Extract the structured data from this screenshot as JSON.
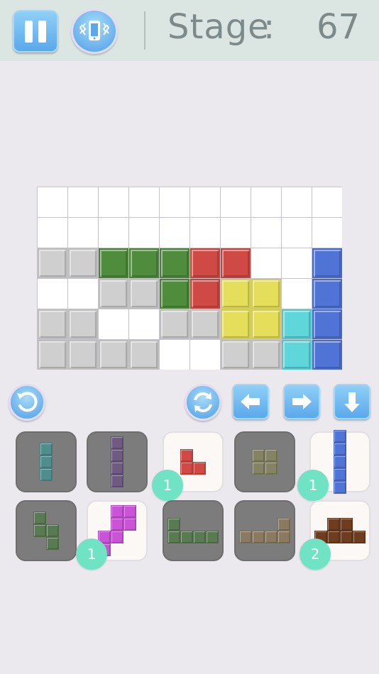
{
  "header": {
    "stage_label": "Stage",
    "stage_colon": ":",
    "stage_number": "67",
    "pause_icon": "pause-icon",
    "vibrate_icon": "phone-vibrate-icon"
  },
  "colors": {
    "gray": "#cfcfcf",
    "green": "#4f8c3c",
    "red": "#d04a45",
    "yellow": "#e5de5a",
    "cyan": "#5fd6d9",
    "blue": "#4f74d6",
    "purple": "#c955d6",
    "brown": "#6e3d1f",
    "teal_dim": "#4f8d8f",
    "purple_dim": "#6f5a82",
    "olive_dim": "#848465",
    "green_dim": "#5a7a54",
    "tan_dim": "#8a7a62"
  },
  "board": {
    "cols": 10,
    "rows": 6,
    "grid": [
      [
        "empty",
        "empty",
        "empty",
        "empty",
        "empty",
        "empty",
        "empty",
        "empty",
        "empty",
        "empty"
      ],
      [
        "empty",
        "empty",
        "empty",
        "empty",
        "empty",
        "empty",
        "empty",
        "empty",
        "empty",
        "empty"
      ],
      [
        "gray",
        "gray",
        "green",
        "green",
        "green",
        "red",
        "red",
        "empty",
        "empty",
        "blue"
      ],
      [
        "empty",
        "empty",
        "gray",
        "gray",
        "green",
        "red",
        "yellow",
        "yellow",
        "empty",
        "blue"
      ],
      [
        "gray",
        "gray",
        "empty",
        "empty",
        "gray",
        "gray",
        "yellow",
        "yellow",
        "cyan",
        "blue"
      ],
      [
        "gray",
        "gray",
        "gray",
        "gray",
        "empty",
        "empty",
        "gray",
        "gray",
        "cyan",
        "blue"
      ]
    ]
  },
  "controls": {
    "undo_icon": "undo-icon",
    "rotate_icon": "rotate-icon",
    "left_icon": "arrow-left-icon",
    "right_icon": "arrow-right-icon",
    "down_icon": "arrow-down-icon"
  },
  "pieces": [
    {
      "state": "used",
      "color": "teal_dim",
      "cells": [
        [
          0,
          0
        ],
        [
          0,
          1
        ],
        [
          0,
          2
        ]
      ],
      "count": ""
    },
    {
      "state": "used",
      "color": "purple_dim",
      "cells": [
        [
          0,
          0
        ],
        [
          0,
          1
        ],
        [
          0,
          2
        ],
        [
          0,
          3
        ]
      ],
      "count": ""
    },
    {
      "state": "available",
      "color": "red",
      "cells": [
        [
          0,
          0
        ],
        [
          0,
          1
        ],
        [
          1,
          1
        ]
      ],
      "count": "1"
    },
    {
      "state": "used",
      "color": "olive_dim",
      "cells": [
        [
          0,
          0
        ],
        [
          1,
          0
        ],
        [
          0,
          1
        ],
        [
          1,
          1
        ]
      ],
      "count": ""
    },
    {
      "state": "available",
      "color": "blue",
      "cells": [
        [
          0,
          0
        ],
        [
          0,
          1
        ],
        [
          0,
          2
        ],
        [
          0,
          3
        ],
        [
          0,
          4
        ]
      ],
      "count": "1"
    },
    {
      "state": "used",
      "color": "green_dim",
      "cells": [
        [
          0,
          0
        ],
        [
          0,
          1
        ],
        [
          1,
          1
        ],
        [
          1,
          2
        ]
      ],
      "count": ""
    },
    {
      "state": "available",
      "color": "purple",
      "cells": [
        [
          1,
          0
        ],
        [
          2,
          0
        ],
        [
          1,
          1
        ],
        [
          2,
          1
        ],
        [
          0,
          2
        ],
        [
          1,
          2
        ],
        [
          0,
          3
        ]
      ],
      "count": "1"
    },
    {
      "state": "used",
      "color": "green_dim",
      "cells": [
        [
          0,
          0
        ],
        [
          0,
          1
        ],
        [
          1,
          1
        ],
        [
          2,
          1
        ],
        [
          3,
          1
        ]
      ],
      "count": ""
    },
    {
      "state": "used",
      "color": "tan_dim",
      "cells": [
        [
          3,
          0
        ],
        [
          0,
          1
        ],
        [
          1,
          1
        ],
        [
          2,
          1
        ],
        [
          3,
          1
        ]
      ],
      "count": ""
    },
    {
      "state": "available",
      "color": "brown",
      "cells": [
        [
          1,
          0
        ],
        [
          2,
          0
        ],
        [
          0,
          1
        ],
        [
          1,
          1
        ],
        [
          2,
          1
        ],
        [
          3,
          1
        ]
      ],
      "count": "2"
    }
  ]
}
